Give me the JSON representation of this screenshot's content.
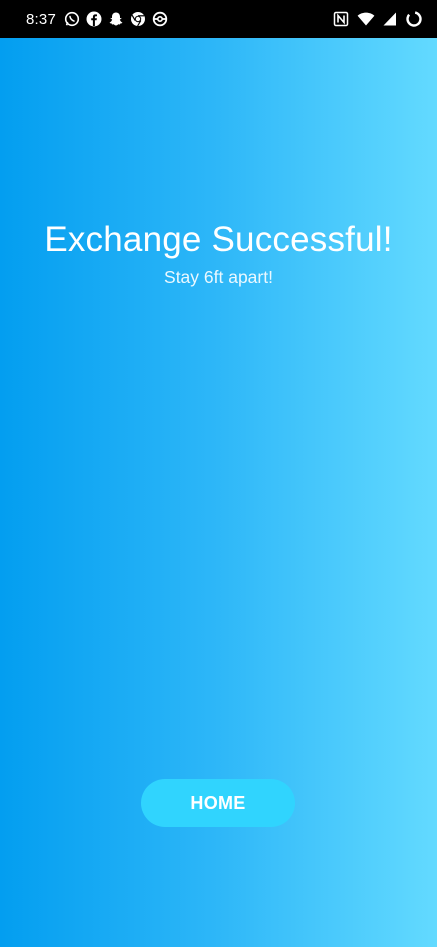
{
  "status_bar": {
    "time": "8:37",
    "notification_icons": [
      "whatsapp-icon",
      "facebook-icon",
      "snapchat-icon",
      "chrome-icon",
      "pokeball-icon"
    ],
    "system_icons": [
      "nfc-icon",
      "wifi-icon",
      "signal-icon",
      "battery-icon"
    ]
  },
  "main": {
    "title": "Exchange Successful!",
    "subtitle": "Stay 6ft apart!",
    "home_button_label": "HOME"
  },
  "colors": {
    "status_bar_bg": "#000000",
    "gradient_left": "#039ef0",
    "gradient_right": "#63daff",
    "button_bg": "#30d4fe",
    "text": "#ffffff"
  }
}
